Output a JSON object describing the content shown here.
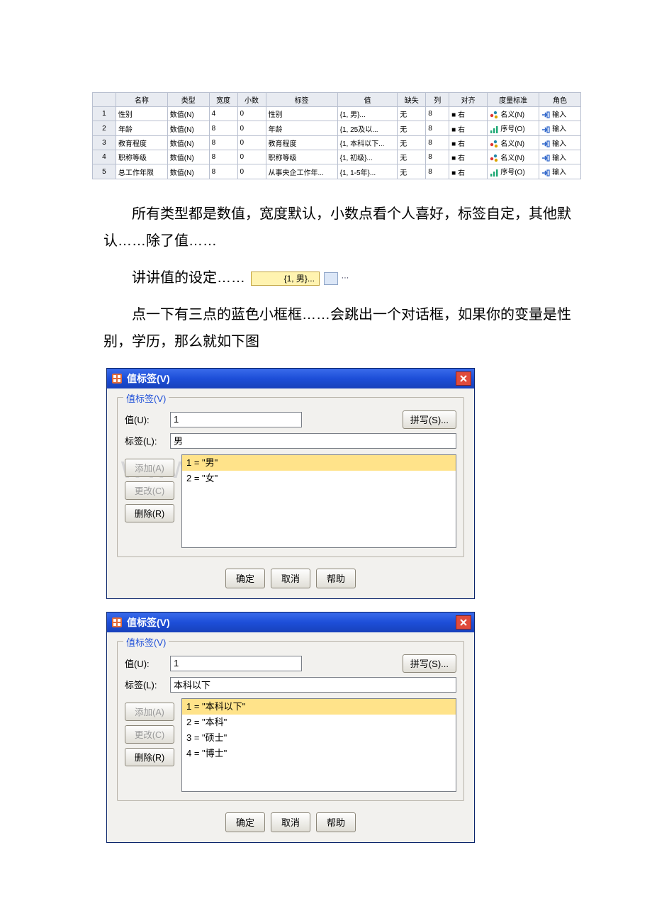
{
  "vartable": {
    "headers": [
      "",
      "名称",
      "类型",
      "宽度",
      "小数",
      "标签",
      "值",
      "缺失",
      "列",
      "对齐",
      "度量标准",
      "角色"
    ],
    "rows": [
      {
        "n": "1",
        "name": "性别",
        "type": "数值(N)",
        "width": "4",
        "dec": "0",
        "label": "性别",
        "value": "{1, 男}...",
        "missing": "无",
        "col": "8",
        "align": "■ 右",
        "measure_icon": "nominal",
        "measure": "名义(N)",
        "role_icon": "input",
        "role": "输入"
      },
      {
        "n": "2",
        "name": "年龄",
        "type": "数值(N)",
        "width": "8",
        "dec": "0",
        "label": "年龄",
        "value": "{1, 25及以...",
        "missing": "无",
        "col": "8",
        "align": "■ 右",
        "measure_icon": "ordinal",
        "measure": "序号(O)",
        "role_icon": "input",
        "role": "输入"
      },
      {
        "n": "3",
        "name": "教育程度",
        "type": "数值(N)",
        "width": "8",
        "dec": "0",
        "label": "教育程度",
        "value": "{1, 本科以下...",
        "missing": "无",
        "col": "8",
        "align": "■ 右",
        "measure_icon": "nominal",
        "measure": "名义(N)",
        "role_icon": "input",
        "role": "输入"
      },
      {
        "n": "4",
        "name": "职称等级",
        "type": "数值(N)",
        "width": "8",
        "dec": "0",
        "label": "职称等级",
        "value": "{1, 初级}...",
        "missing": "无",
        "col": "8",
        "align": "■ 右",
        "measure_icon": "nominal",
        "measure": "名义(N)",
        "role_icon": "input",
        "role": "输入"
      },
      {
        "n": "5",
        "name": "总工作年限",
        "type": "数值(N)",
        "width": "8",
        "dec": "0",
        "label": "从事央企工作年...",
        "value": "{1, 1-5年}...",
        "missing": "无",
        "col": "8",
        "align": "■ 右",
        "measure_icon": "ordinal",
        "measure": "序号(O)",
        "role_icon": "input",
        "role": "输入"
      }
    ]
  },
  "para1": "所有类型都是数值，宽度默认，小数点看个人喜好，标签自定，其他默认……除了值……",
  "para2_prefix": "讲讲值的设定……",
  "valcell_text": "{1, 男}...",
  "valcell_btn": "···",
  "para3": "点一下有三点的蓝色小框框……会跳出一个对话框，如果你的变量是性别，学历，那么就如下图",
  "dialog_common": {
    "title": "值标签(V)",
    "group_legend": "值标签(V)",
    "value_label": "值(U):",
    "label_label": "标签(L):",
    "spell": "拼写(S)...",
    "add": "添加(A)",
    "change": "更改(C)",
    "remove": "删除(R)",
    "ok": "确定",
    "cancel": "取消",
    "help": "帮助"
  },
  "dialog1": {
    "value_input": "1",
    "label_input": "男",
    "options": [
      "1 = \"男\"",
      "2 = \"女\""
    ],
    "selected_index": 0
  },
  "dialog2": {
    "value_input": "1",
    "label_input": "本科以下",
    "options": [
      "1 = \"本科以下\"",
      "2 = \"本科\"",
      "3 = \"硕士\"",
      "4 = \"博士\""
    ],
    "selected_index": 0
  },
  "watermark": "www.bdocx.com"
}
